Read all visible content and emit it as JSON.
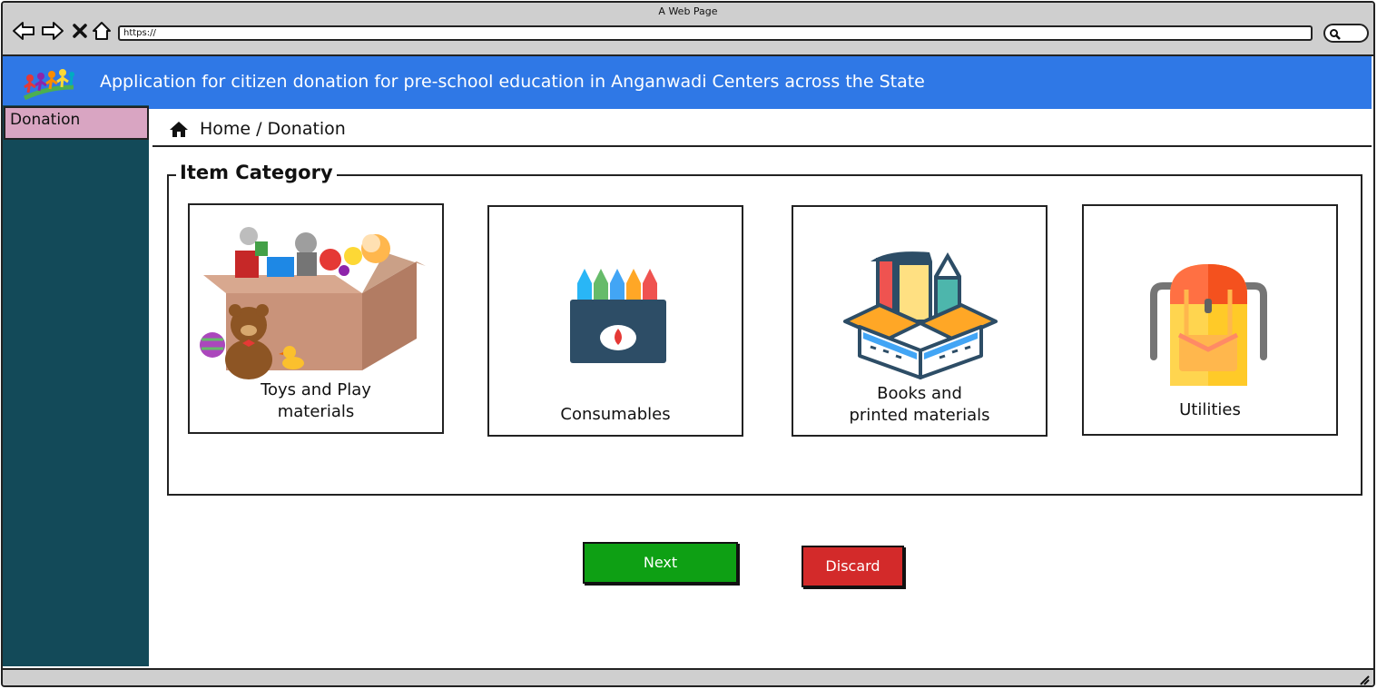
{
  "window": {
    "title": "A Web Page"
  },
  "browser": {
    "url": "https://"
  },
  "banner": {
    "title": "Application for citizen donation for pre-school education in Anganwadi Centers across the State"
  },
  "sidebar": {
    "items": [
      {
        "label": "Donation"
      }
    ]
  },
  "breadcrumb": {
    "home": "Home",
    "separator": "/",
    "current": "Donation"
  },
  "category": {
    "legend": "Item Category",
    "cards": [
      {
        "line1": "Toys and Play",
        "line2": "materials",
        "icon": "toy-box-icon"
      },
      {
        "line1": "Consumables",
        "line2": "",
        "icon": "crayon-box-icon"
      },
      {
        "line1": "Books and",
        "line2": "printed materials",
        "icon": "books-box-icon"
      },
      {
        "line1": "Utilities",
        "line2": "",
        "icon": "backpack-icon"
      }
    ]
  },
  "actions": {
    "next": "Next",
    "discard": "Discard"
  },
  "colors": {
    "banner": "#2f78e6",
    "sidebar": "#134a59",
    "sidebar_item": "#d9a5c2",
    "next": "#0ea014",
    "discard": "#d32a2a"
  }
}
